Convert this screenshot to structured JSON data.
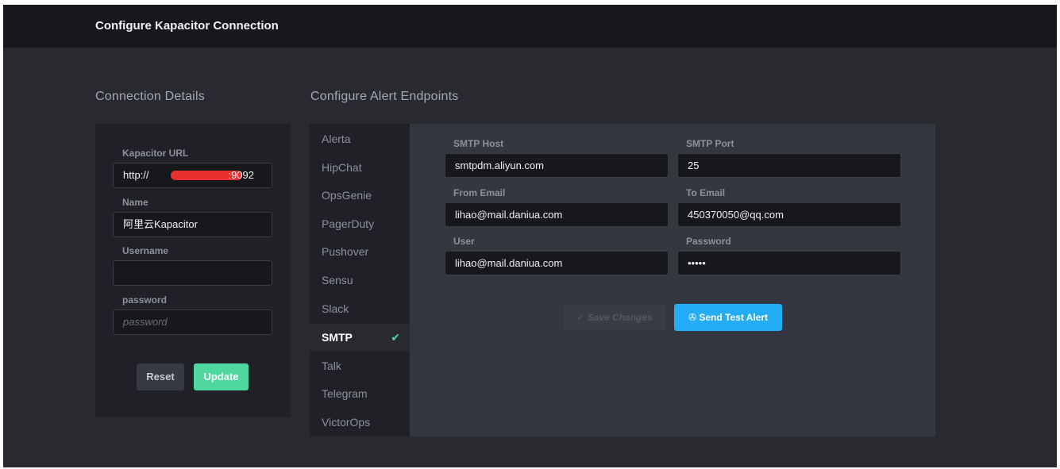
{
  "header": {
    "title": "Configure Kapacitor Connection"
  },
  "connection": {
    "section_title": "Connection Details",
    "url_label": "Kapacitor URL",
    "url_prefix": "http://",
    "url_suffix": ":9092",
    "name_label": "Name",
    "name_value": "阿里云Kapacitor",
    "username_label": "Username",
    "username_value": "",
    "password_label": "password",
    "password_placeholder": "password",
    "reset_label": "Reset",
    "update_label": "Update"
  },
  "endpoints": {
    "section_title": "Configure Alert Endpoints",
    "items": [
      {
        "label": "Alerta"
      },
      {
        "label": "HipChat"
      },
      {
        "label": "OpsGenie"
      },
      {
        "label": "PagerDuty"
      },
      {
        "label": "Pushover"
      },
      {
        "label": "Sensu"
      },
      {
        "label": "Slack"
      },
      {
        "label": "SMTP",
        "active": true
      },
      {
        "label": "Talk"
      },
      {
        "label": "Telegram"
      },
      {
        "label": "VictorOps"
      }
    ],
    "active_icon": "check-icon"
  },
  "smtp": {
    "host_label": "SMTP Host",
    "host_value": "smtpdm.aliyun.com",
    "port_label": "SMTP Port",
    "port_value": "25",
    "from_label": "From Email",
    "from_value": "lihao@mail.daniua.com",
    "to_label": "To Email",
    "to_value": "450370050@qq.com",
    "user_label": "User",
    "user_value": "lihao@mail.daniua.com",
    "password_label": "Password",
    "password_value": "•••••",
    "save_label": "✓ Save Changes",
    "test_label": "Send Test Alert"
  },
  "colors": {
    "accent_green": "#4ed8a0",
    "accent_blue": "#22adf6",
    "redaction": "#e8302e"
  }
}
